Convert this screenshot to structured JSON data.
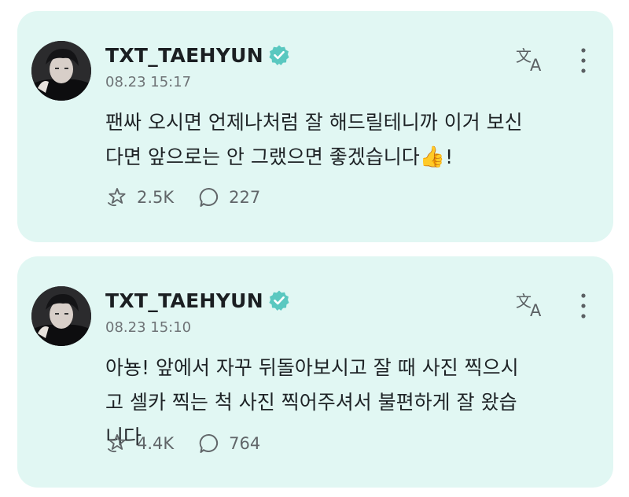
{
  "posts": [
    {
      "username": "TXT_TAEHYUN",
      "timestamp": "08.23 15:17",
      "body_lines": [
        "팬싸 오시면 언제나처럼 잘 해드릴테니까 이거 보신",
        "다면 앞으로는 안 그랬으면 좋겠습니다"
      ],
      "body_emoji": "👍",
      "body_tail": "!",
      "likes": "2.5K",
      "comments": "227"
    },
    {
      "username": "TXT_TAEHYUN",
      "timestamp": "08.23 15:10",
      "body_lines": [
        "아뇽! 앞에서 자꾸 뒤돌아보시고 잘 때 사진 찍으시",
        "고 셀카 찍는 척 사진 찍어주셔서 불편하게 잘 왔습",
        "니다"
      ],
      "likes": "4.4K",
      "comments": "764"
    }
  ],
  "icons": {
    "verified": "verified-badge-icon",
    "translate": "translate-icon",
    "more": "more-vertical-icon",
    "like": "like-icon",
    "comment": "comment-icon"
  },
  "colors": {
    "card_background": "#e1f7f3",
    "verified_badge": "#5ac8c0",
    "text": "#1e2326",
    "muted_text": "#6e7376"
  }
}
